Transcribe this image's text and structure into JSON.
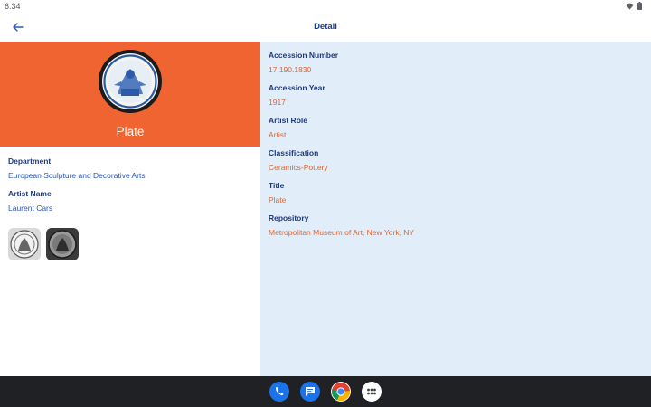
{
  "status_bar": {
    "time": "6:34"
  },
  "app_bar": {
    "title": "Detail",
    "back_icon": "arrow-back-icon"
  },
  "hero": {
    "title": "Plate",
    "background_color": "#ef6430"
  },
  "left_fields": [
    {
      "label": "Department",
      "value": "European Sculpture and Decorative Arts"
    },
    {
      "label": "Artist Name",
      "value": "Laurent Cars"
    }
  ],
  "right_fields": [
    {
      "label": "Accession Number",
      "value": "17.190.1830"
    },
    {
      "label": "Accession Year",
      "value": "1917"
    },
    {
      "label": "Artist Role",
      "value": "Artist"
    },
    {
      "label": "Classification",
      "value": "Ceramics-Pottery"
    },
    {
      "label": "Title",
      "value": "Plate"
    },
    {
      "label": "Repository",
      "value": "Metropolitan Museum of Art, New York, NY"
    }
  ],
  "colors": {
    "label": "#1f3a7a",
    "left_value": "#2a58b8",
    "right_value": "#e8642d",
    "right_pane_bg": "#e1edf9"
  },
  "taskbar": {
    "apps": [
      "phone-icon",
      "messages-icon",
      "chrome-icon",
      "app-drawer-icon"
    ]
  }
}
